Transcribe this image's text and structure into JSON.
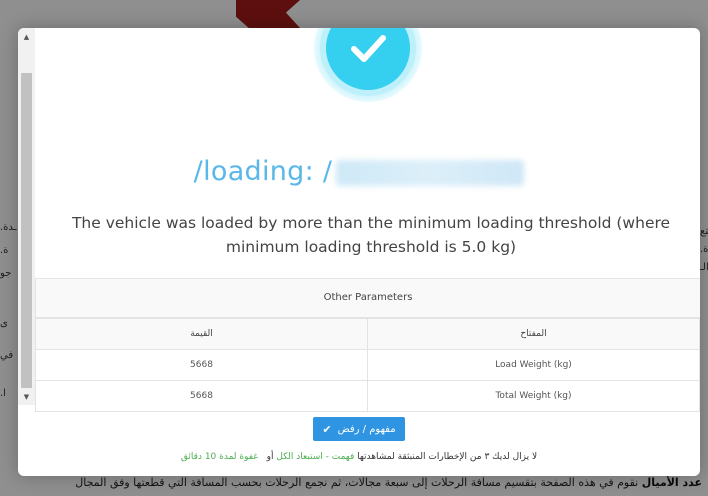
{
  "background": {
    "bottom_bold": "عدد الأميال",
    "bottom_text": "نقوم في هذه الصفحة بتقسيم مسافة الرحلات إلى سبعة مجالات، ثم نجمع الرحلات بحسب المسافة التي قطعتها وفق المجال",
    "fragments": [
      "التع",
      "ة.",
      "ـدة.",
      "والـ",
      "جو",
      "ى",
      "في",
      "ا."
    ]
  },
  "modal": {
    "status_icon": "checkmark-icon",
    "title_prefix": "/loading: /",
    "message": "The vehicle was loaded by more than the minimum loading threshold (where minimum loading threshold is 5.0 kg)",
    "params": {
      "caption": "Other Parameters",
      "columns": {
        "value": "القيمة",
        "key": "المفتاح"
      },
      "rows": [
        {
          "value": "5668",
          "key": "Load Weight (kg)"
        },
        {
          "value": "5668",
          "key": "Total Weight (kg)"
        }
      ]
    },
    "ok_button": "مفهوم / رفض",
    "footer": {
      "text": "لا يزال لديك ٣ من الإخطارات المنبثقة لمشاهدتها",
      "link_dismiss": "فهمت - استبعاد الكل",
      "or": "أو",
      "link_snooze": "غفوة لمدة 10 دقائق"
    }
  },
  "colors": {
    "accent": "#35d0ef",
    "title": "#59b7e9",
    "button": "#2f95e3",
    "link": "#4caf50"
  }
}
